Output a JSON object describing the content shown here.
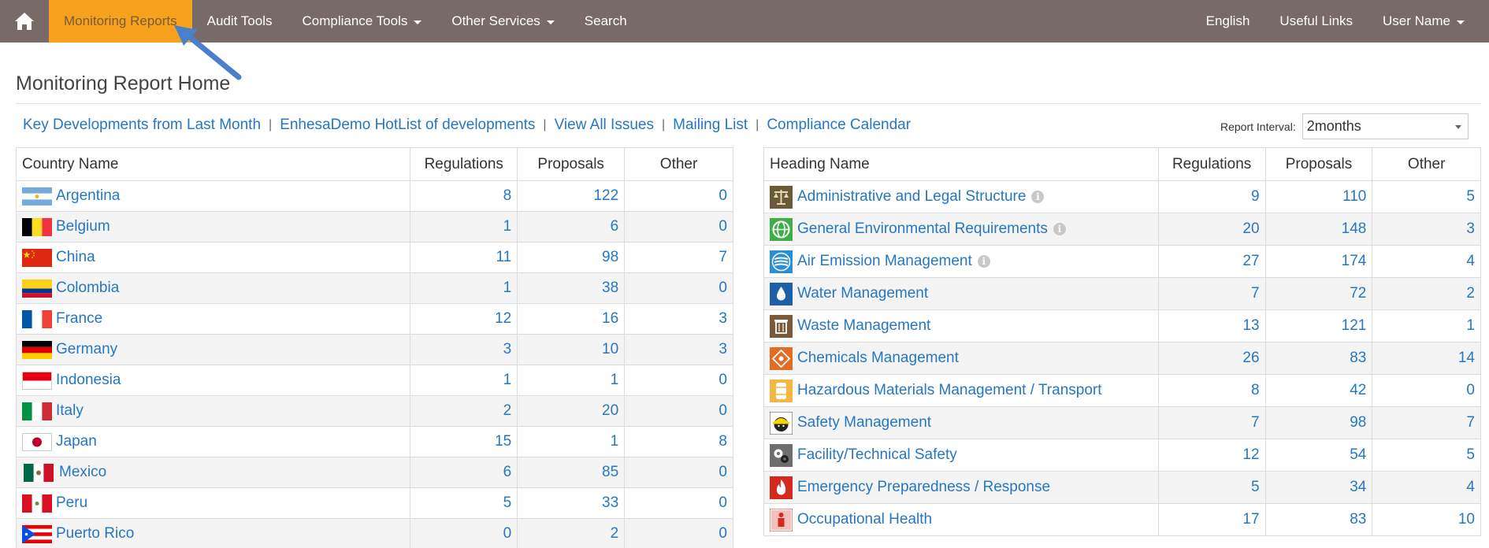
{
  "nav": {
    "home_icon": "home-icon",
    "items": [
      {
        "label": "Monitoring Reports",
        "active": true,
        "dropdown": false
      },
      {
        "label": "Audit Tools",
        "active": false,
        "dropdown": false
      },
      {
        "label": "Compliance Tools",
        "active": false,
        "dropdown": true
      },
      {
        "label": "Other Services",
        "active": false,
        "dropdown": true
      },
      {
        "label": "Search",
        "active": false,
        "dropdown": false
      }
    ],
    "right_items": [
      {
        "label": "English",
        "dropdown": false
      },
      {
        "label": "Useful Links",
        "dropdown": false
      },
      {
        "label": "User Name",
        "dropdown": true
      }
    ]
  },
  "page_title": "Monitoring Report Home",
  "links": [
    "Key Developments from Last Month",
    "EnhesaDemo HotList of developments",
    "View All Issues",
    "Mailing List",
    "Compliance Calendar"
  ],
  "report_interval": {
    "label": "Report Interval:",
    "value": "2months"
  },
  "country_table": {
    "headers": [
      "Country Name",
      "Regulations",
      "Proposals",
      "Other"
    ],
    "rows": [
      {
        "name": "Argentina",
        "flag": "argentina-flag",
        "regulations": "8",
        "proposals": "122",
        "other": "0"
      },
      {
        "name": "Belgium",
        "flag": "belgium-flag",
        "regulations": "1",
        "proposals": "6",
        "other": "0"
      },
      {
        "name": "China",
        "flag": "china-flag",
        "regulations": "11",
        "proposals": "98",
        "other": "7"
      },
      {
        "name": "Colombia",
        "flag": "colombia-flag",
        "regulations": "1",
        "proposals": "38",
        "other": "0"
      },
      {
        "name": "France",
        "flag": "france-flag",
        "regulations": "12",
        "proposals": "16",
        "other": "3"
      },
      {
        "name": "Germany",
        "flag": "germany-flag",
        "regulations": "3",
        "proposals": "10",
        "other": "3"
      },
      {
        "name": "Indonesia",
        "flag": "indonesia-flag",
        "regulations": "1",
        "proposals": "1",
        "other": "0"
      },
      {
        "name": "Italy",
        "flag": "italy-flag",
        "regulations": "2",
        "proposals": "20",
        "other": "0"
      },
      {
        "name": "Japan",
        "flag": "japan-flag",
        "regulations": "15",
        "proposals": "1",
        "other": "8"
      },
      {
        "name": "Mexico",
        "flag": "mexico-flag",
        "regulations": "6",
        "proposals": "85",
        "other": "0"
      },
      {
        "name": "Peru",
        "flag": "peru-flag",
        "regulations": "5",
        "proposals": "33",
        "other": "0"
      },
      {
        "name": "Puerto Rico",
        "flag": "puerto-rico-flag",
        "regulations": "0",
        "proposals": "2",
        "other": "0"
      }
    ]
  },
  "heading_table": {
    "headers": [
      "Heading Name",
      "Regulations",
      "Proposals",
      "Other"
    ],
    "rows": [
      {
        "name": "Administrative and Legal Structure",
        "icon": "scales-icon",
        "info": true,
        "regulations": "9",
        "proposals": "110",
        "other": "5"
      },
      {
        "name": "General Environmental Requirements",
        "icon": "globe-icon",
        "info": true,
        "regulations": "20",
        "proposals": "148",
        "other": "3"
      },
      {
        "name": "Air Emission Management",
        "icon": "air-icon",
        "info": true,
        "regulations": "27",
        "proposals": "174",
        "other": "4"
      },
      {
        "name": "Water Management",
        "icon": "water-drop-icon",
        "info": false,
        "regulations": "7",
        "proposals": "72",
        "other": "2"
      },
      {
        "name": "Waste Management",
        "icon": "trash-bin-icon",
        "info": false,
        "regulations": "13",
        "proposals": "121",
        "other": "1"
      },
      {
        "name": "Chemicals Management",
        "icon": "chemical-hazard-icon",
        "info": false,
        "regulations": "26",
        "proposals": "83",
        "other": "14"
      },
      {
        "name": "Hazardous Materials Management / Transport",
        "icon": "barrel-icon",
        "info": false,
        "regulations": "8",
        "proposals": "42",
        "other": "0"
      },
      {
        "name": "Safety Management",
        "icon": "hard-hat-icon",
        "info": false,
        "regulations": "7",
        "proposals": "98",
        "other": "7"
      },
      {
        "name": "Facility/Technical Safety",
        "icon": "gears-icon",
        "info": false,
        "regulations": "12",
        "proposals": "54",
        "other": "5"
      },
      {
        "name": "Emergency Preparedness / Response",
        "icon": "flame-icon",
        "info": false,
        "regulations": "5",
        "proposals": "34",
        "other": "4"
      },
      {
        "name": "Occupational Health",
        "icon": "worker-icon",
        "info": false,
        "regulations": "17",
        "proposals": "83",
        "other": "10"
      }
    ]
  },
  "colors": {
    "navbar": "#786a66",
    "active_tab": "#f7a21c",
    "link": "#2677c2",
    "arrow": "#4a7fc9"
  }
}
